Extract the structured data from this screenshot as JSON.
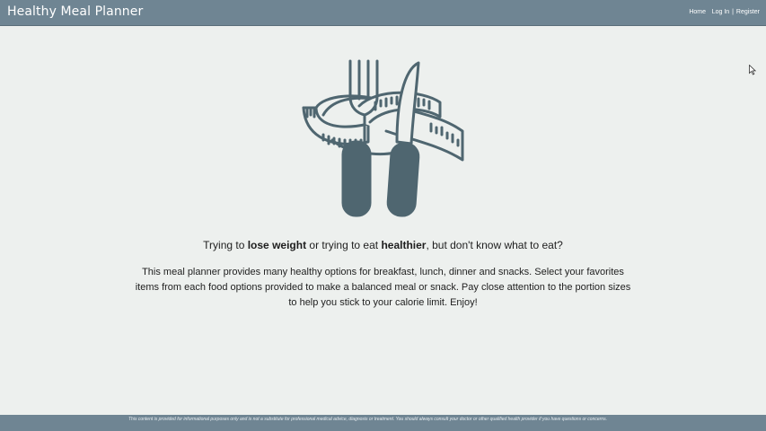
{
  "navbar": {
    "brand": "Healthy Meal Planner",
    "home_label": "Home",
    "login_label": "Log In",
    "separator": "|",
    "register_label": "Register"
  },
  "hero": {
    "icon": "fork-knife-measuring-tape-icon",
    "icon_color": "#4f6670"
  },
  "main": {
    "tagline_prefix": "Trying to ",
    "tagline_bold1": "lose weight",
    "tagline_mid": " or trying to eat ",
    "tagline_bold2": "healthier",
    "tagline_suffix": ", but don't know what to eat?",
    "description": "This meal planner provides many healthy options for breakfast, lunch, dinner and snacks. Select your favorites items from each food options provided to make a balanced meal or snack. Pay close attention to the portion sizes to help you stick to your calorie limit. Enjoy!"
  },
  "footer": {
    "disclaimer": "This content is provided for informational purposes only and is not a substitute for professional medical advice, diagnosis or treatment. You should always consult your doctor or other qualified health provider if you have questions or concerns."
  },
  "colors": {
    "navbar_bg": "#6f8593",
    "page_bg": "#edf0ee",
    "footer_bg": "#6f8593"
  }
}
